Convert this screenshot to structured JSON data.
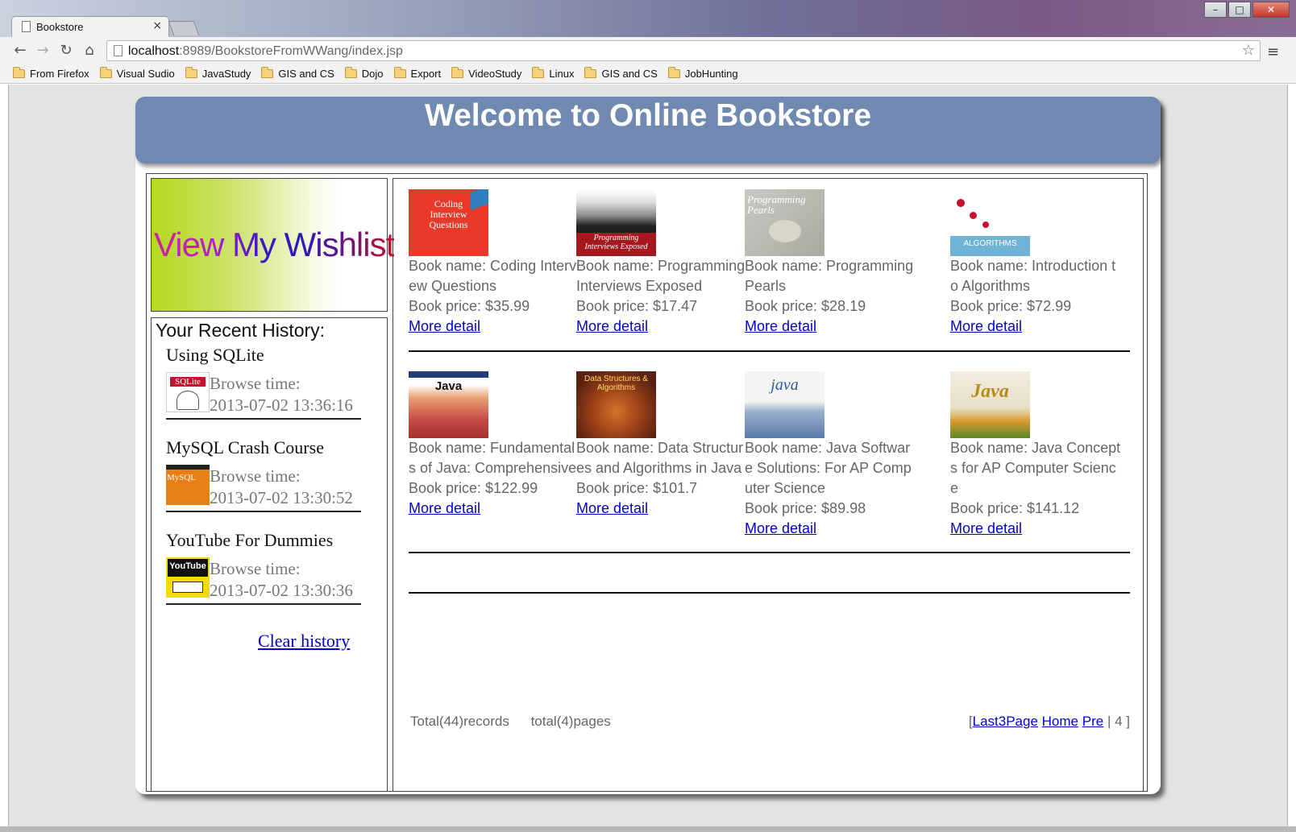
{
  "browser": {
    "tab_title": "Bookstore",
    "url_host": "localhost",
    "url_rest": ":8989/BookstoreFromWWang/index.jsp",
    "bookmarks": [
      "From Firefox",
      "Visual Sudio",
      "JavaStudy",
      "GIS and CS",
      "Dojo",
      "Export",
      "VideoStudy",
      "Linux",
      "GIS and CS",
      "JobHunting"
    ]
  },
  "header": {
    "title": "Welcome to Online Bookstore"
  },
  "wishlist": {
    "label": "View My Wishlist"
  },
  "history": {
    "heading": "Your Recent History:",
    "items": [
      {
        "title": "Using SQLite",
        "browse_label": "Browse time:",
        "time": "2013-07-02 13:36:16",
        "cover_text": "SQLite"
      },
      {
        "title": "MySQL Crash Course",
        "browse_label": "Browse time:",
        "time": "2013-07-02 13:30:52",
        "cover_text": "MySQL"
      },
      {
        "title": "YouTube For Dummies",
        "browse_label": "Browse time:",
        "time": "2013-07-02 13:30:36",
        "cover_text": "YouTube"
      }
    ],
    "clear_label": "Clear history"
  },
  "books": [
    {
      "name": "Book name: Coding Interview Questions",
      "price": "Book price: $35.99",
      "more": "More detail",
      "cover_text": "Coding Interview Questions"
    },
    {
      "name": "Book name: Programming Interviews Exposed",
      "price": "Book price: $17.47",
      "more": "More detail",
      "cover_text": "Programming Interviews Exposed"
    },
    {
      "name": "Book name: Programming Pearls",
      "price": "Book price: $28.19",
      "more": "More detail",
      "cover_text": "Programming Pearls"
    },
    {
      "name": "Book name: Introduction to Algorithms",
      "price": "Book price: $72.99",
      "more": "More detail",
      "cover_text": "ALGORITHMS"
    },
    {
      "name": "Book name: Fundamentals of Java: Comprehensive",
      "price": "Book price: $122.99",
      "more": "More detail",
      "cover_text": "Java"
    },
    {
      "name": "Book name: Data Structures and Algorithms in Java",
      "price": "Book price: $101.7",
      "more": "More detail",
      "cover_text": "Data Structures & Algorithms"
    },
    {
      "name": "Book name: Java Software Solutions: For AP Computer Science",
      "price": "Book price: $89.98",
      "more": "More detail",
      "cover_text": "java"
    },
    {
      "name": "Book name: Java Concepts for AP Computer Science",
      "price": "Book price: $141.12",
      "more": "More detail",
      "cover_text": "Java"
    }
  ],
  "pager": {
    "total_records": "Total(44)records",
    "total_pages": "total(4)pages",
    "open_bracket": "[",
    "last3": "Last3Page",
    "home": "Home",
    "pre": "Pre",
    "current": "| 4  ]"
  }
}
